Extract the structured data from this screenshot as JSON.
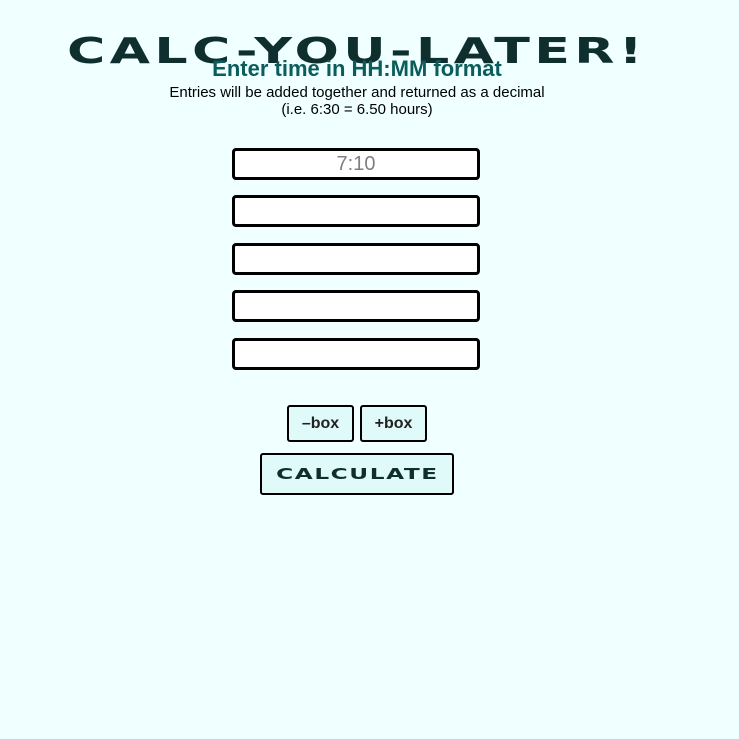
{
  "header": {
    "title": "CALC-YOU-LATER!",
    "subtitle": "Enter time in HH:MM format",
    "description_line1": "Entries will be added together and returned as a decimal",
    "description_line2": "(i.e. 6:30 = 6.50 hours)"
  },
  "inputs": [
    {
      "value": "",
      "placeholder": "7:10"
    },
    {
      "value": "",
      "placeholder": ""
    },
    {
      "value": "",
      "placeholder": ""
    },
    {
      "value": "",
      "placeholder": ""
    },
    {
      "value": "",
      "placeholder": ""
    }
  ],
  "buttons": {
    "remove_box_label": "–box",
    "add_box_label": "+box",
    "calculate_label": "CALCULATE"
  },
  "colors": {
    "background": "#f0ffff",
    "title": "#0f2f2f",
    "subtitle": "#0b5c5c",
    "button_bg": "#e0fafa"
  }
}
